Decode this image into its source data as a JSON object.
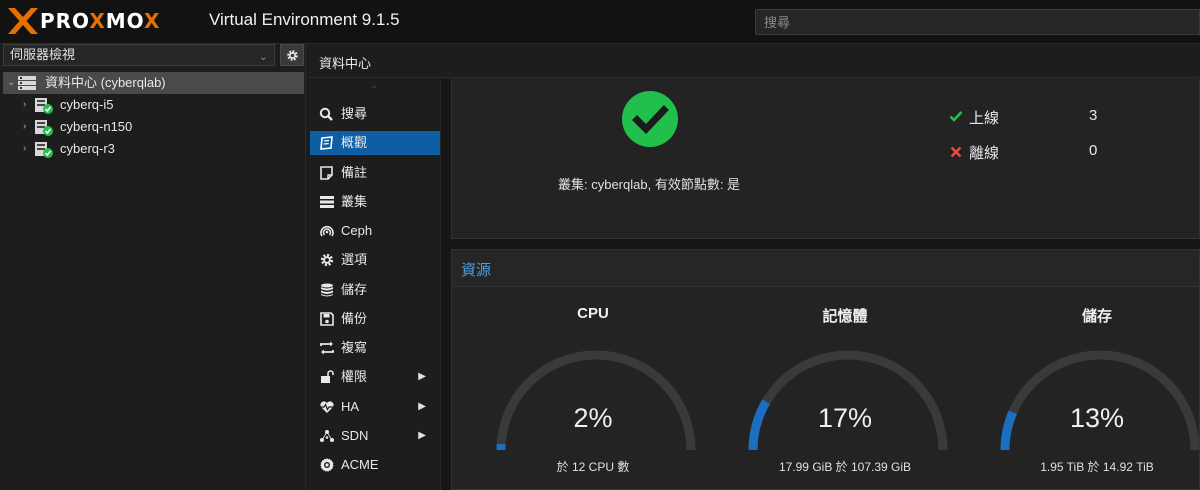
{
  "header": {
    "logo_text_a": "PRO",
    "logo_text_b": "X",
    "logo_text_c": "MO",
    "logo_text_d": "X",
    "product": "Virtual Environment 9.1.5",
    "search_placeholder": "搜尋"
  },
  "sidebar": {
    "view_selector": "伺服器檢視",
    "tree": [
      {
        "label": "資料中心 (cyberqlab)",
        "icon": "datacenter-icon"
      },
      {
        "label": "cyberq-i5",
        "icon": "node-online-icon"
      },
      {
        "label": "cyberq-n150",
        "icon": "node-online-icon"
      },
      {
        "label": "cyberq-r3",
        "icon": "node-online-icon"
      }
    ]
  },
  "breadcrumb": "資料中心",
  "nav": [
    {
      "label": "搜尋",
      "icon": "search-icon"
    },
    {
      "label": "概觀",
      "icon": "book-icon",
      "active": true
    },
    {
      "label": "備註",
      "icon": "note-icon"
    },
    {
      "label": "叢集",
      "icon": "server-icon"
    },
    {
      "label": "Ceph",
      "icon": "ceph-icon"
    },
    {
      "label": "選項",
      "icon": "gear-icon"
    },
    {
      "label": "儲存",
      "icon": "database-icon"
    },
    {
      "label": "備份",
      "icon": "floppy-icon"
    },
    {
      "label": "複寫",
      "icon": "retweet-icon"
    },
    {
      "label": "權限",
      "icon": "unlock-icon",
      "submenu": true
    },
    {
      "label": "HA",
      "icon": "heartbeat-icon",
      "submenu": true
    },
    {
      "label": "SDN",
      "icon": "network-icon",
      "submenu": true
    },
    {
      "label": "ACME",
      "icon": "certificate-icon"
    }
  ],
  "status": {
    "cluster_line": "叢集: cyberqlab, 有效節點數: 是",
    "online_label": "上線",
    "online_count": "3",
    "offline_label": "離線",
    "offline_count": "0"
  },
  "resources": {
    "title": "資源",
    "gauges": [
      {
        "title": "CPU",
        "value": "2%",
        "fraction": 0.02,
        "sub": "於 12 CPU 數"
      },
      {
        "title": "記憶體",
        "value": "17%",
        "fraction": 0.17,
        "sub": "17.99 GiB 於 107.39 GiB"
      },
      {
        "title": "儲存",
        "value": "13%",
        "fraction": 0.13,
        "sub": "1.95 TiB 於 14.92 TiB"
      }
    ]
  },
  "colors": {
    "accent": "#0e5ea6",
    "gauge_fill": "#1b6fc1",
    "gauge_track": "#3a3a3a",
    "ok_green": "#21bf4b",
    "error_red": "#e74c3c",
    "logo_orange": "#e57000"
  }
}
